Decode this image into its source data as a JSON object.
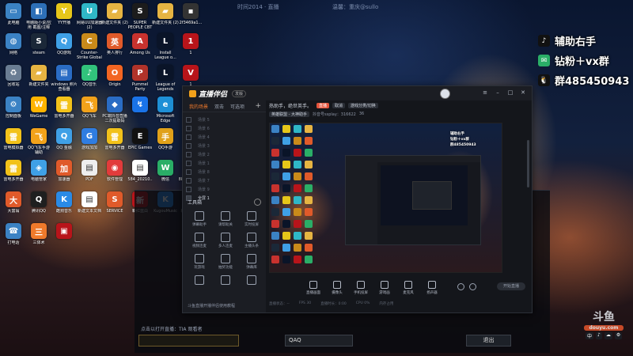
{
  "top_bar": {
    "left_text": "时间2014 · 直播",
    "center_text": "温馨：重庆@sullo"
  },
  "desktop_icons": [
    {
      "label": "此电脑",
      "color": "#3b82c4",
      "glyph": "▭"
    },
    {
      "label": "电脑版小说/应用 截图/注释",
      "color": "#2d6fb8",
      "glyph": "◧"
    },
    {
      "label": "YY开播",
      "color": "#e6c619",
      "glyph": "Y"
    },
    {
      "label": "网易UU加速器 (2)",
      "color": "#2fb7c7",
      "glyph": "U"
    },
    {
      "label": "新建文件夹 (2)",
      "color": "#e6b442",
      "glyph": "▰"
    },
    {
      "label": "SUPER PEOPLE CBT",
      "color": "#1c1c1c",
      "glyph": "S"
    },
    {
      "label": "新建文件夹 (2)",
      "color": "#e6b442",
      "glyph": "▰"
    },
    {
      "label": "2f3469a1...",
      "color": "#333",
      "glyph": "▪"
    },
    {
      "label": "网络",
      "color": "#3b82c4",
      "glyph": "◍"
    },
    {
      "label": "steam",
      "color": "#1b2838",
      "glyph": "S"
    },
    {
      "label": "QQ游戏",
      "color": "#3fa0e6",
      "glyph": "Q"
    },
    {
      "label": "Counter-Strike Global Off...",
      "color": "#c98a1a",
      "glyph": "C"
    },
    {
      "label": "英人排行",
      "color": "#e05a2a",
      "glyph": "英"
    },
    {
      "label": "Among Us",
      "color": "#c8322e",
      "glyph": "A"
    },
    {
      "label": "Install League o...",
      "color": "#0a1428",
      "glyph": "L"
    },
    {
      "label": "1",
      "color": "#b8141a",
      "glyph": "1"
    },
    {
      "label": "回收站",
      "color": "#6a7d93",
      "glyph": "♻"
    },
    {
      "label": "新建文件夹",
      "color": "#e6b442",
      "glyph": "▰"
    },
    {
      "label": "windows 照片查看器",
      "color": "#2a6cc4",
      "glyph": "▤"
    },
    {
      "label": "QQ音乐",
      "color": "#31c27c",
      "glyph": "♪"
    },
    {
      "label": "Origin",
      "color": "#f26522",
      "glyph": "O"
    },
    {
      "label": "Pummel Party",
      "color": "#b0332a",
      "glyph": "P"
    },
    {
      "label": "League of Legends",
      "color": "#0a1428",
      "glyph": "L"
    },
    {
      "label": "1",
      "color": "#b8141a",
      "glyph": "V"
    },
    {
      "label": "控制面板",
      "color": "#3b82c4",
      "glyph": "⚙"
    },
    {
      "label": "WeGame",
      "color": "#ffb400",
      "glyph": "W"
    },
    {
      "label": "雷电多开器",
      "color": "#f2c21a",
      "glyph": "雷"
    },
    {
      "label": "QQ飞车",
      "color": "#f2a21a",
      "glyph": "飞"
    },
    {
      "label": "PC端抖音直播 二次提取码",
      "color": "#2a6cc4",
      "glyph": "◆"
    },
    {
      "label": "",
      "color": "#1a73e8",
      "glyph": "↯"
    },
    {
      "label": "Microsoft Edge",
      "color": "#1e8fd6",
      "glyph": "e"
    },
    {
      "label": "QAQ",
      "color": "#e0a11a",
      "glyph": "Q"
    },
    {
      "label": "雷电模拟器",
      "color": "#f2c21a",
      "glyph": "雷"
    },
    {
      "label": "QQ飞车手游 辅助",
      "color": "#f2a21a",
      "glyph": "飞"
    },
    {
      "label": "QQ 金融",
      "color": "#3fa0e6",
      "glyph": "Q"
    },
    {
      "label": "游戏加加",
      "color": "#2f7de1",
      "glyph": "G"
    },
    {
      "label": "雷电多开器",
      "color": "#f2c21a",
      "glyph": "雷"
    },
    {
      "label": "EPIC Games",
      "color": "#111",
      "glyph": "E"
    },
    {
      "label": "QQ手游",
      "color": "#e0a11a",
      "glyph": "手"
    },
    {
      "label": "yy",
      "color": "#e6c619",
      "glyph": "yy"
    },
    {
      "label": "雷电多开器",
      "color": "#f2c21a",
      "glyph": "雷"
    },
    {
      "label": "电脑管家",
      "color": "#3fa0e6",
      "glyph": "◈"
    },
    {
      "label": "加速器",
      "color": "#e05a2a",
      "glyph": "加"
    },
    {
      "label": "PDF",
      "color": "#eee",
      "glyph": "▤"
    },
    {
      "label": "软件管理",
      "color": "#e23b3b",
      "glyph": "◉"
    },
    {
      "label": "584_20210..",
      "color": "#fff",
      "glyph": "▤"
    },
    {
      "label": "微信",
      "color": "#2aae67",
      "glyph": "W"
    },
    {
      "label": "88707D2E...",
      "color": "#fff",
      "glyph": "▤"
    },
    {
      "label": "大富翁",
      "color": "#e05a2a",
      "glyph": "大"
    },
    {
      "label": "腾讯QQ",
      "color": "#1f1f1f",
      "glyph": "Q"
    },
    {
      "label": "酷狗音乐",
      "color": "#2a8ae6",
      "glyph": "K"
    },
    {
      "label": "新建文本文档",
      "color": "#fff",
      "glyph": "▤"
    },
    {
      "label": "SERVICE",
      "color": "#e05a2a",
      "glyph": "S"
    },
    {
      "label": "新红蓝白",
      "color": "#b8141a",
      "glyph": "新"
    },
    {
      "label": "KugouMusic",
      "color": "#2a8ae6",
      "glyph": "K"
    },
    {
      "label": "新建文件夹",
      "color": "#e6b442",
      "glyph": "▰"
    },
    {
      "label": "打电话",
      "color": "#3b82c4",
      "glyph": "☎"
    },
    {
      "label": "三体术",
      "color": "#f07a2b",
      "glyph": "三"
    },
    {
      "label": "",
      "color": "#b8141a",
      "glyph": "▣"
    }
  ],
  "promo": [
    {
      "icon": "tiktok-icon",
      "glyph": "♪",
      "color": "#111",
      "text": "辅助右手"
    },
    {
      "icon": "wechat-icon",
      "glyph": "✉",
      "color": "#2aae67",
      "text": "钻粉＋vx群"
    },
    {
      "icon": "qq-icon",
      "glyph": "🐧",
      "color": "#111",
      "text": "群485450943"
    }
  ],
  "app": {
    "brand": "直播伴侣",
    "badge": "发版",
    "left_tabs": [
      "我的场景",
      "双击",
      "可选项"
    ],
    "scenes": [
      "场景 5",
      "场景 6",
      "场景 4",
      "场景 3",
      "场景 2",
      "场景 1",
      "场景 8",
      "场景 7",
      "场景 9",
      "全屏 1"
    ],
    "tools_title": "工具箱",
    "tools": [
      "弹幕助手",
      "请帮助关",
      "实时投屏",
      "视频连麦",
      "多人连麦",
      "主播头条",
      "玩游戏",
      "抽奖功能",
      "弹幕库",
      "",
      "",
      ""
    ],
    "bottom_note": "斗鱼直播开播伴侣使用教程",
    "subbar": {
      "title": "热助手，绝世英手。",
      "red": "直播",
      "btn1": "取消",
      "btn2": "游戏分类/切换"
    },
    "subbar2": {
      "chip": "英雄联盟 - 大神助手",
      "id": "抖音号ssplay：316622",
      "likes": "36"
    },
    "main_buttons": [
      "直播画面",
      "摄像头",
      "手机投屏",
      "游戏画",
      "麦克风",
      "扬声器"
    ],
    "start_label": "开始直播",
    "status": [
      "直播状态：--",
      "FPS 30",
      "直播时长：0:00",
      "CPU 0%",
      "内存占用"
    ]
  },
  "bg_window": {
    "hint": "点击以打开直播：TIA 观看者",
    "game_value": "QAQ",
    "exit_label": "退出"
  },
  "watermark": {
    "big": "斗鱼",
    "small": "douyu.com"
  },
  "tray": [
    "中",
    "♪",
    "☁",
    "⚙"
  ]
}
